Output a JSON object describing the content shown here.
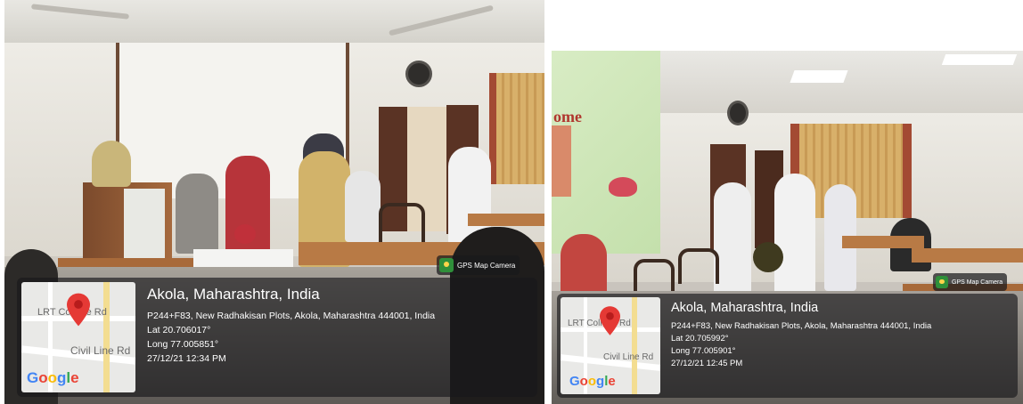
{
  "photos": [
    {
      "gps_badge": "GPS Map Camera",
      "map": {
        "labels": [
          "LRT College Rd",
          "Civil Line Rd"
        ],
        "brand": "Google"
      },
      "location": {
        "place": "Akola, Maharashtra, India",
        "address": "P244+F83, New Radhakisan Plots, Akola, Maharashtra 444001, India",
        "lat": "Lat 20.706017°",
        "long": "Long 77.005851°",
        "datetime": "27/12/21 12:34 PM"
      }
    },
    {
      "gps_badge": "GPS Map Camera",
      "screen_text": "ome",
      "map": {
        "labels": [
          "LRT College Rd",
          "Civil Line Rd"
        ],
        "brand": "Google"
      },
      "location": {
        "place": "Akola, Maharashtra, India",
        "address": "P244+F83, New Radhakisan Plots, Akola, Maharashtra 444001, India",
        "lat": "Lat 20.705992°",
        "long": "Long 77.005901°",
        "datetime": "27/12/21 12:45 PM"
      }
    }
  ],
  "colors": {
    "overlay_bg": "#19191c",
    "map_pin": "#e53935",
    "gps_icon": "#2f8f3a",
    "curtain": "#d2a760",
    "curtain_frame": "#a34a33",
    "desk": "#b87a45",
    "projection": "#cfe6b8"
  },
  "icons": [
    "map-pin-icon",
    "gps-map-camera-icon",
    "google-logo"
  ]
}
